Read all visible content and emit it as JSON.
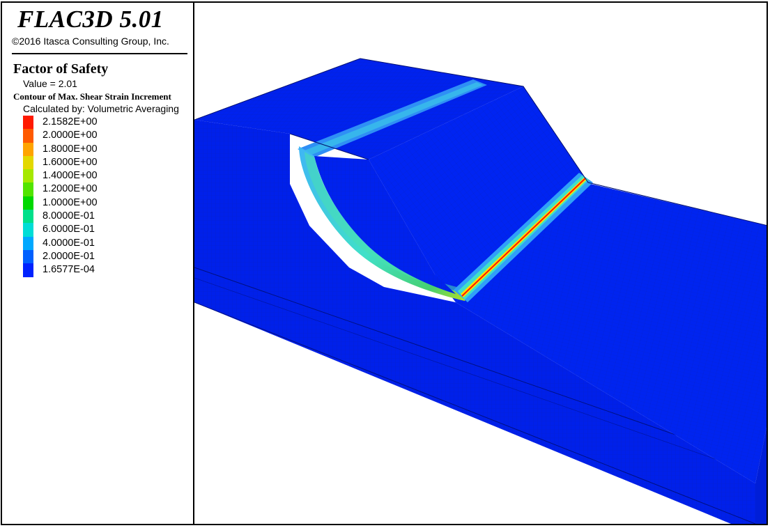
{
  "header": {
    "app_title": "FLAC3D 5.01",
    "copyright": "©2016 Itasca Consulting Group, Inc."
  },
  "analysis": {
    "title": "Factor of Safety",
    "value_text": "Value = 2.01"
  },
  "contour": {
    "title": "Contour of Max. Shear Strain Increment",
    "calculated_by": "Calculated by: Volumetric Averaging",
    "scale": [
      {
        "label": "2.1582E+00",
        "color": "#ff1a00"
      },
      {
        "label": "2.0000E+00",
        "color": "#ff5a00"
      },
      {
        "label": "1.8000E+00",
        "color": "#ffa400"
      },
      {
        "label": "1.6000E+00",
        "color": "#e3d800"
      },
      {
        "label": "1.4000E+00",
        "color": "#a6e800"
      },
      {
        "label": "1.2000E+00",
        "color": "#52e400"
      },
      {
        "label": "1.0000E+00",
        "color": "#00d800"
      },
      {
        "label": "8.0000E-01",
        "color": "#00e08a"
      },
      {
        "label": "6.0000E-01",
        "color": "#00ddd6"
      },
      {
        "label": "4.0000E-01",
        "color": "#00a8ff"
      },
      {
        "label": "2.0000E-01",
        "color": "#0060ff"
      },
      {
        "label": "1.6577E-04",
        "color": "#0022ff"
      }
    ]
  },
  "model_colors": {
    "base": "#0022ee",
    "mesh": "#001a99",
    "band_light": "#33aaf0",
    "band_cyan": "#40e8d8",
    "band_green": "#30d080",
    "band_red": "#ff1800",
    "band_yellow": "#ffe000"
  }
}
